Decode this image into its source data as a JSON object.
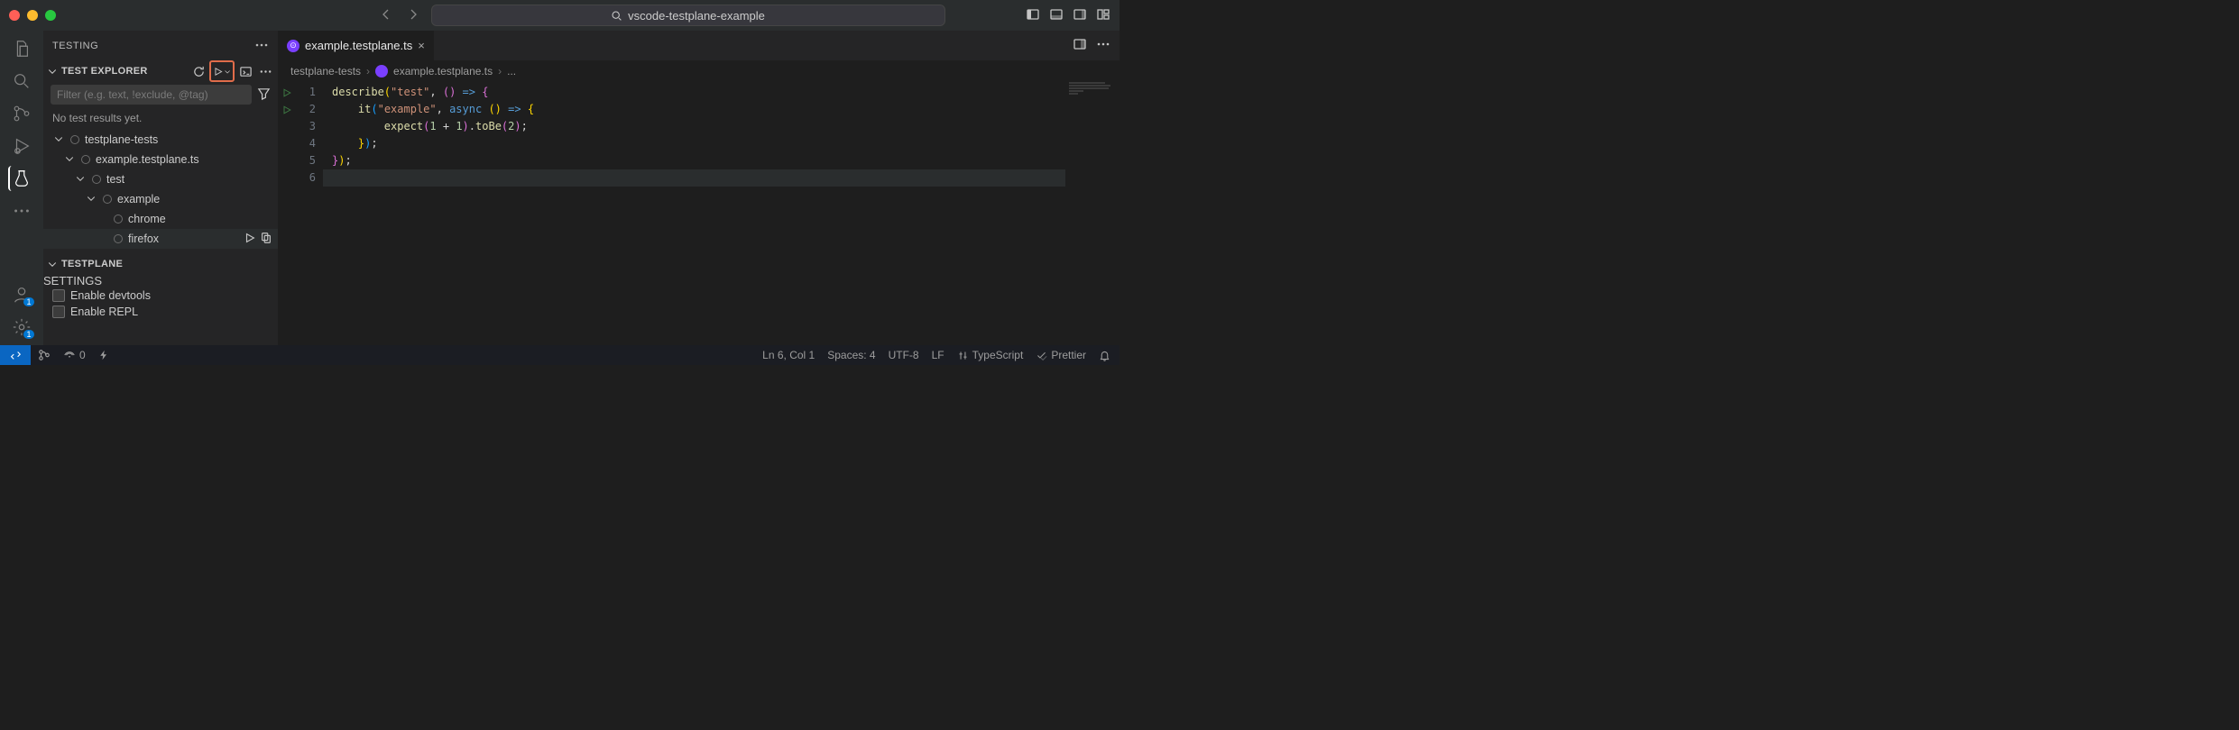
{
  "titlebar": {
    "search_text": "vscode-testplane-example"
  },
  "activitybar": {
    "icons": [
      "files",
      "search",
      "scm",
      "debug",
      "testing",
      "more"
    ],
    "bottom_icons": [
      "account",
      "settings"
    ],
    "account_badge": "1",
    "settings_badge": "1"
  },
  "sidebar": {
    "title": "TESTING",
    "explorer": {
      "title": "TEST EXPLORER",
      "filter_placeholder": "Filter (e.g. text, !exclude, @tag)",
      "no_results": "No test results yet.",
      "tree": [
        {
          "label": "testplane-tests",
          "depth": 0,
          "expanded": true
        },
        {
          "label": "example.testplane.ts",
          "depth": 1,
          "expanded": true
        },
        {
          "label": "test",
          "depth": 2,
          "expanded": true
        },
        {
          "label": "example",
          "depth": 3,
          "expanded": true
        },
        {
          "label": "chrome",
          "depth": 4,
          "leaf": true
        },
        {
          "label": "firefox",
          "depth": 4,
          "leaf": true,
          "hovered": true
        }
      ]
    },
    "testplane": {
      "title": "TESTPLANE",
      "settings_label": "SETTINGS",
      "options": [
        {
          "label": "Enable devtools"
        },
        {
          "label": "Enable REPL"
        }
      ]
    }
  },
  "editor": {
    "tab": {
      "filename": "example.testplane.ts"
    },
    "breadcrumb": {
      "folder": "testplane-tests",
      "file": "example.testplane.ts",
      "more": "..."
    },
    "code_lines": {
      "1": "describe(\"test\", () => {",
      "2": "    it(\"example\", async () => {",
      "3": "        expect(1 + 1).toBe(2);",
      "4": "    });",
      "5": "});",
      "6": ""
    },
    "line_numbers": [
      "1",
      "2",
      "3",
      "4",
      "5",
      "6"
    ]
  },
  "statusbar": {
    "ports": "0",
    "cursor": "Ln 6, Col 1",
    "spaces": "Spaces: 4",
    "encoding": "UTF-8",
    "eol": "LF",
    "language": "TypeScript",
    "prettier": "Prettier"
  }
}
